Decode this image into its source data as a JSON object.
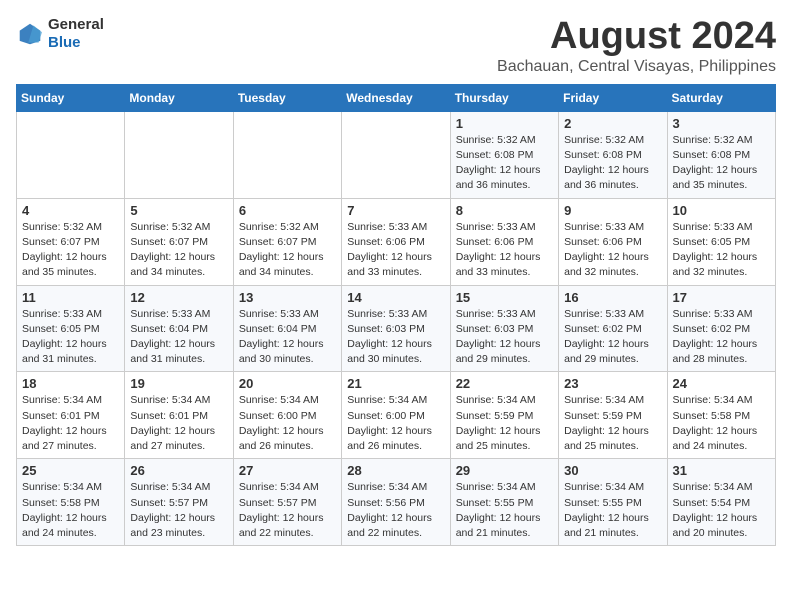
{
  "header": {
    "logo_general": "General",
    "logo_blue": "Blue",
    "title": "August 2024",
    "subtitle": "Bachauan, Central Visayas, Philippines"
  },
  "weekdays": [
    "Sunday",
    "Monday",
    "Tuesday",
    "Wednesday",
    "Thursday",
    "Friday",
    "Saturday"
  ],
  "weeks": [
    [
      {
        "day": "",
        "info": ""
      },
      {
        "day": "",
        "info": ""
      },
      {
        "day": "",
        "info": ""
      },
      {
        "day": "",
        "info": ""
      },
      {
        "day": "1",
        "info": "Sunrise: 5:32 AM\nSunset: 6:08 PM\nDaylight: 12 hours\nand 36 minutes."
      },
      {
        "day": "2",
        "info": "Sunrise: 5:32 AM\nSunset: 6:08 PM\nDaylight: 12 hours\nand 36 minutes."
      },
      {
        "day": "3",
        "info": "Sunrise: 5:32 AM\nSunset: 6:08 PM\nDaylight: 12 hours\nand 35 minutes."
      }
    ],
    [
      {
        "day": "4",
        "info": "Sunrise: 5:32 AM\nSunset: 6:07 PM\nDaylight: 12 hours\nand 35 minutes."
      },
      {
        "day": "5",
        "info": "Sunrise: 5:32 AM\nSunset: 6:07 PM\nDaylight: 12 hours\nand 34 minutes."
      },
      {
        "day": "6",
        "info": "Sunrise: 5:32 AM\nSunset: 6:07 PM\nDaylight: 12 hours\nand 34 minutes."
      },
      {
        "day": "7",
        "info": "Sunrise: 5:33 AM\nSunset: 6:06 PM\nDaylight: 12 hours\nand 33 minutes."
      },
      {
        "day": "8",
        "info": "Sunrise: 5:33 AM\nSunset: 6:06 PM\nDaylight: 12 hours\nand 33 minutes."
      },
      {
        "day": "9",
        "info": "Sunrise: 5:33 AM\nSunset: 6:06 PM\nDaylight: 12 hours\nand 32 minutes."
      },
      {
        "day": "10",
        "info": "Sunrise: 5:33 AM\nSunset: 6:05 PM\nDaylight: 12 hours\nand 32 minutes."
      }
    ],
    [
      {
        "day": "11",
        "info": "Sunrise: 5:33 AM\nSunset: 6:05 PM\nDaylight: 12 hours\nand 31 minutes."
      },
      {
        "day": "12",
        "info": "Sunrise: 5:33 AM\nSunset: 6:04 PM\nDaylight: 12 hours\nand 31 minutes."
      },
      {
        "day": "13",
        "info": "Sunrise: 5:33 AM\nSunset: 6:04 PM\nDaylight: 12 hours\nand 30 minutes."
      },
      {
        "day": "14",
        "info": "Sunrise: 5:33 AM\nSunset: 6:03 PM\nDaylight: 12 hours\nand 30 minutes."
      },
      {
        "day": "15",
        "info": "Sunrise: 5:33 AM\nSunset: 6:03 PM\nDaylight: 12 hours\nand 29 minutes."
      },
      {
        "day": "16",
        "info": "Sunrise: 5:33 AM\nSunset: 6:02 PM\nDaylight: 12 hours\nand 29 minutes."
      },
      {
        "day": "17",
        "info": "Sunrise: 5:33 AM\nSunset: 6:02 PM\nDaylight: 12 hours\nand 28 minutes."
      }
    ],
    [
      {
        "day": "18",
        "info": "Sunrise: 5:34 AM\nSunset: 6:01 PM\nDaylight: 12 hours\nand 27 minutes."
      },
      {
        "day": "19",
        "info": "Sunrise: 5:34 AM\nSunset: 6:01 PM\nDaylight: 12 hours\nand 27 minutes."
      },
      {
        "day": "20",
        "info": "Sunrise: 5:34 AM\nSunset: 6:00 PM\nDaylight: 12 hours\nand 26 minutes."
      },
      {
        "day": "21",
        "info": "Sunrise: 5:34 AM\nSunset: 6:00 PM\nDaylight: 12 hours\nand 26 minutes."
      },
      {
        "day": "22",
        "info": "Sunrise: 5:34 AM\nSunset: 5:59 PM\nDaylight: 12 hours\nand 25 minutes."
      },
      {
        "day": "23",
        "info": "Sunrise: 5:34 AM\nSunset: 5:59 PM\nDaylight: 12 hours\nand 25 minutes."
      },
      {
        "day": "24",
        "info": "Sunrise: 5:34 AM\nSunset: 5:58 PM\nDaylight: 12 hours\nand 24 minutes."
      }
    ],
    [
      {
        "day": "25",
        "info": "Sunrise: 5:34 AM\nSunset: 5:58 PM\nDaylight: 12 hours\nand 24 minutes."
      },
      {
        "day": "26",
        "info": "Sunrise: 5:34 AM\nSunset: 5:57 PM\nDaylight: 12 hours\nand 23 minutes."
      },
      {
        "day": "27",
        "info": "Sunrise: 5:34 AM\nSunset: 5:57 PM\nDaylight: 12 hours\nand 22 minutes."
      },
      {
        "day": "28",
        "info": "Sunrise: 5:34 AM\nSunset: 5:56 PM\nDaylight: 12 hours\nand 22 minutes."
      },
      {
        "day": "29",
        "info": "Sunrise: 5:34 AM\nSunset: 5:55 PM\nDaylight: 12 hours\nand 21 minutes."
      },
      {
        "day": "30",
        "info": "Sunrise: 5:34 AM\nSunset: 5:55 PM\nDaylight: 12 hours\nand 21 minutes."
      },
      {
        "day": "31",
        "info": "Sunrise: 5:34 AM\nSunset: 5:54 PM\nDaylight: 12 hours\nand 20 minutes."
      }
    ]
  ]
}
